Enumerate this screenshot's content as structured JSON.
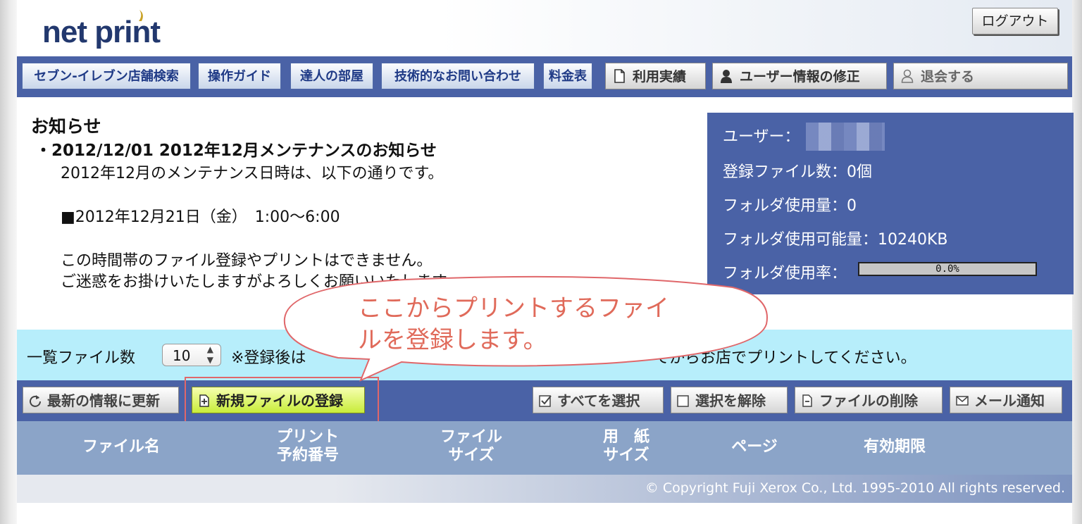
{
  "header": {
    "logo": "net print",
    "logout_label": "ログアウト"
  },
  "nav": {
    "items": [
      {
        "label": "セブン-イレブン店舗検索"
      },
      {
        "label": "操作ガイド"
      },
      {
        "label": "達人の部屋"
      },
      {
        "label": "技術的なお問い合わせ"
      },
      {
        "label": "料金表"
      }
    ],
    "account": [
      {
        "label": "利用実績",
        "icon": "document-icon"
      },
      {
        "label": "ユーザー情報の修正",
        "icon": "user-icon"
      },
      {
        "label": "退会する",
        "icon": "user-outline-icon"
      }
    ]
  },
  "news": {
    "title": "お知らせ",
    "headline": "・2012/12/01  2012年12月メンテナンスのお知らせ",
    "lines": [
      "2012年12月のメンテナンス日時は、以下の通りです。",
      "■2012年12月21日（金）　1:00〜6:00",
      "この時間帯のファイル登録やプリントはできません。",
      "ご迷惑をお掛けいたしますがよろしくお願いいたします。"
    ]
  },
  "info": {
    "user_label": "ユーザー：",
    "files_label": "登録ファイル数：0個",
    "folder_used_label": "フォルダ使用量：0",
    "folder_capacity_label": "フォルダ使用可能量：10240KB",
    "folder_rate_label": "フォルダ使用率：",
    "folder_rate_value": "0.0%",
    "folder_rate_fraction": 0.0
  },
  "file_count": {
    "label": "一覧ファイル数",
    "selected": "10",
    "note_before": "※登録後は",
    "note_after": "てからお店でプリントしてください。"
  },
  "actions": {
    "refresh": "最新の情報に更新",
    "new_file": "新規ファイルの登録",
    "select_all": "すべてを選択",
    "deselect": "選択を解除",
    "delete": "ファイルの削除",
    "mail": "メール通知"
  },
  "table": {
    "columns": [
      {
        "line1": "ファイル名",
        "line2": ""
      },
      {
        "line1": "プリント",
        "line2": "予約番号"
      },
      {
        "line1": "ファイル",
        "line2": "サイズ"
      },
      {
        "line1": "用　紙",
        "line2": "サイズ"
      },
      {
        "line1": "ページ",
        "line2": ""
      },
      {
        "line1": "有効期限",
        "line2": ""
      }
    ]
  },
  "footer": {
    "copyright": "© Copyright Fuji Xerox Co., Ltd. 1995-2010 All rights reserved."
  },
  "callout": {
    "line1": "ここからプリントするファイ",
    "line2": "ルを登録します。",
    "color": "#e06a5a"
  }
}
